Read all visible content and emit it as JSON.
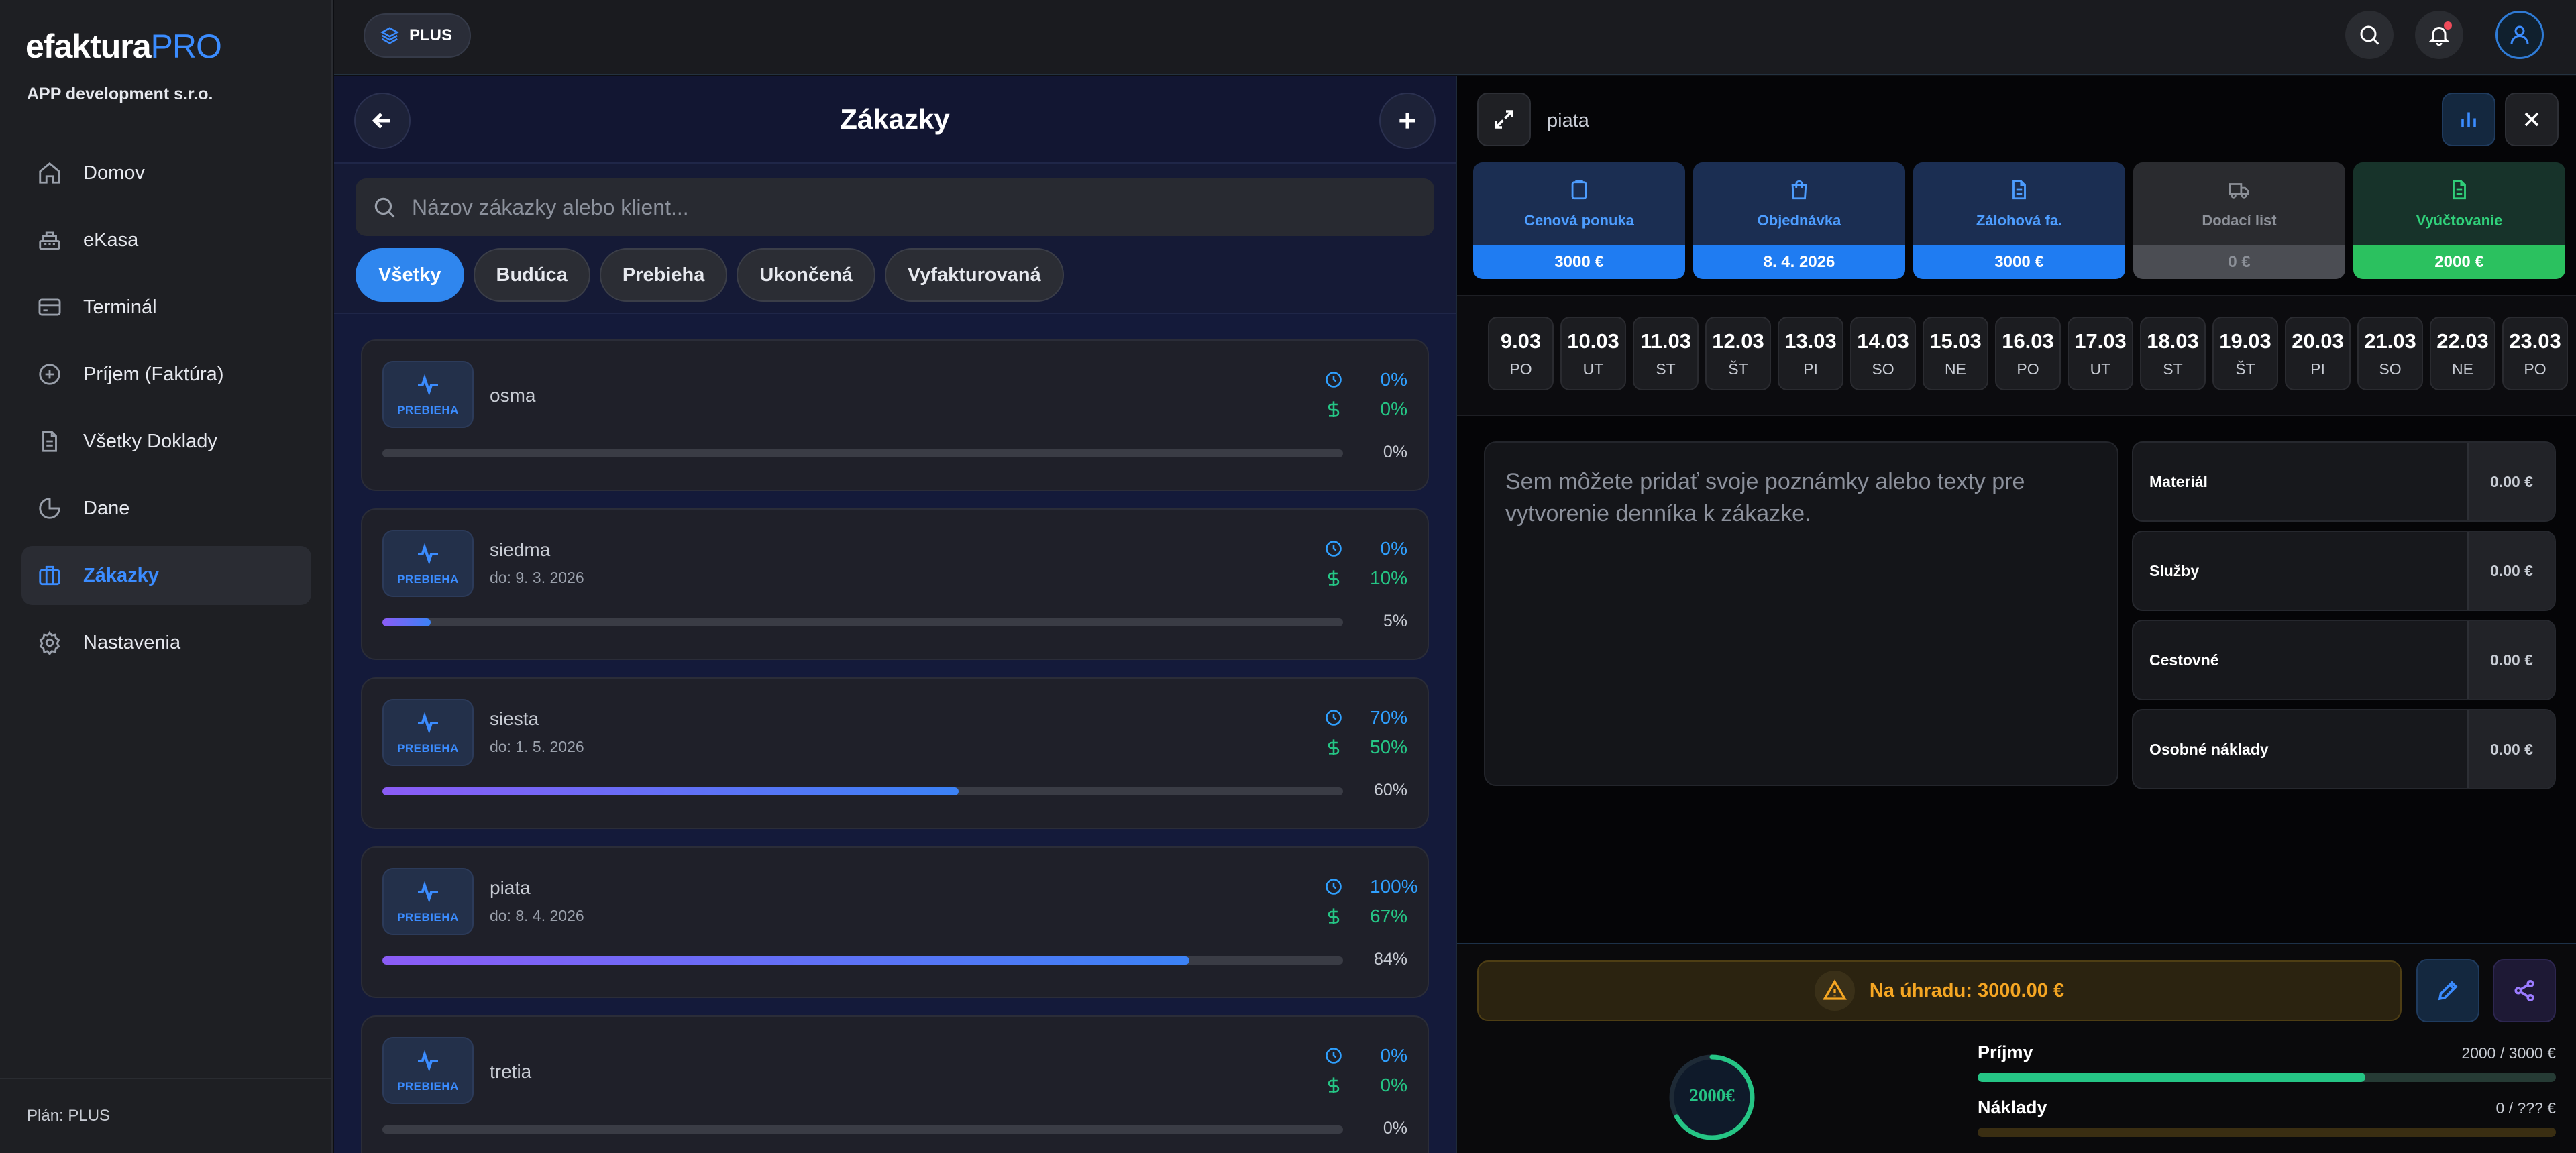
{
  "app": {
    "logo_part1": "efaktura",
    "logo_part2": "PRO",
    "company": "APP development s.r.o.",
    "plan": "Plán: PLUS",
    "accent": "#3b8cff"
  },
  "sidebar": {
    "items": [
      {
        "label": "Domov",
        "icon": "home-icon"
      },
      {
        "label": "eKasa",
        "icon": "cash-register-icon"
      },
      {
        "label": "Terminál",
        "icon": "credit-card-icon"
      },
      {
        "label": "Príjem (Faktúra)",
        "icon": "plus-circle-icon"
      },
      {
        "label": "Všetky Doklady",
        "icon": "document-icon"
      },
      {
        "label": "Dane",
        "icon": "pie-chart-icon"
      },
      {
        "label": "Zákazky",
        "icon": "briefcase-icon",
        "active": true
      },
      {
        "label": "Nastavenia",
        "icon": "gear-icon"
      }
    ]
  },
  "topbar": {
    "plan_badge": "PLUS"
  },
  "orders": {
    "title": "Zákazky",
    "search_placeholder": "Názov zákazky alebo klient...",
    "filters": [
      "Všetky",
      "Budúca",
      "Prebieha",
      "Ukončená",
      "Vyfakturovaná"
    ],
    "active_filter": "Všetky",
    "items": [
      {
        "name": "osma",
        "due": "",
        "status": "PREBIEHA",
        "time": "0%",
        "money": "0%",
        "progress": 0,
        "progress_label": "0%"
      },
      {
        "name": "siedma",
        "due": "do: 9. 3. 2026",
        "status": "PREBIEHA",
        "time": "0%",
        "money": "10%",
        "progress": 5,
        "progress_label": "5%"
      },
      {
        "name": "siesta",
        "due": "do: 1. 5. 2026",
        "status": "PREBIEHA",
        "time": "70%",
        "money": "50%",
        "progress": 60,
        "progress_label": "60%"
      },
      {
        "name": "piata",
        "due": "do: 8. 4. 2026",
        "status": "PREBIEHA",
        "time": "100%",
        "money": "67%",
        "progress": 84,
        "progress_label": "84%"
      },
      {
        "name": "tretia",
        "due": "",
        "status": "PREBIEHA",
        "time": "0%",
        "money": "0%",
        "progress": 0,
        "progress_label": "0%"
      }
    ]
  },
  "detail": {
    "name": "piata",
    "documents": [
      {
        "label": "Cenová ponuka",
        "value": "3000 €",
        "style": "blue",
        "icon": "clipboard-icon"
      },
      {
        "label": "Objednávka",
        "value": "8. 4. 2026",
        "style": "blue",
        "icon": "shopping-bag-icon"
      },
      {
        "label": "Zálohová fa.",
        "value": "3000 €",
        "style": "blue",
        "icon": "file-text-icon"
      },
      {
        "label": "Dodací list",
        "value": "0 €",
        "style": "gray",
        "icon": "truck-icon"
      },
      {
        "label": "Vyúčtovanie",
        "value": "2000 €",
        "style": "green",
        "icon": "file-check-icon"
      }
    ],
    "dates": [
      {
        "d": "9.03",
        "w": "PO"
      },
      {
        "d": "10.03",
        "w": "UT"
      },
      {
        "d": "11.03",
        "w": "ST"
      },
      {
        "d": "12.03",
        "w": "ŠT"
      },
      {
        "d": "13.03",
        "w": "PI"
      },
      {
        "d": "14.03",
        "w": "SO"
      },
      {
        "d": "15.03",
        "w": "NE"
      },
      {
        "d": "16.03",
        "w": "PO"
      },
      {
        "d": "17.03",
        "w": "UT"
      },
      {
        "d": "18.03",
        "w": "ST"
      },
      {
        "d": "19.03",
        "w": "ŠT"
      },
      {
        "d": "20.03",
        "w": "PI"
      },
      {
        "d": "21.03",
        "w": "SO"
      },
      {
        "d": "22.03",
        "w": "NE"
      },
      {
        "d": "23.03",
        "w": "PO"
      }
    ],
    "notes_placeholder": "Sem môžete pridať svoje poznámky alebo texty pre vytvorenie denníka k zákazke.",
    "costs": [
      {
        "label": "Materiál",
        "value": "0.00 €"
      },
      {
        "label": "Služby",
        "value": "0.00 €"
      },
      {
        "label": "Cestovné",
        "value": "0.00 €"
      },
      {
        "label": "Osobné náklady",
        "value": "0.00 €"
      }
    ],
    "due_text": "Na úhradu: 3000.00 €",
    "gauge_label": "2000€",
    "gauge_fraction": 0.67,
    "income_label": "Príjmy",
    "income_value": "2000 / 3000 €",
    "income_fraction": 0.67,
    "expense_label": "Náklady",
    "expense_value": "0 / ??? €",
    "expense_fraction": 0,
    "colors": {
      "income": "#25c585",
      "expense": "#3a2e12",
      "warning": "#f5a623"
    }
  }
}
